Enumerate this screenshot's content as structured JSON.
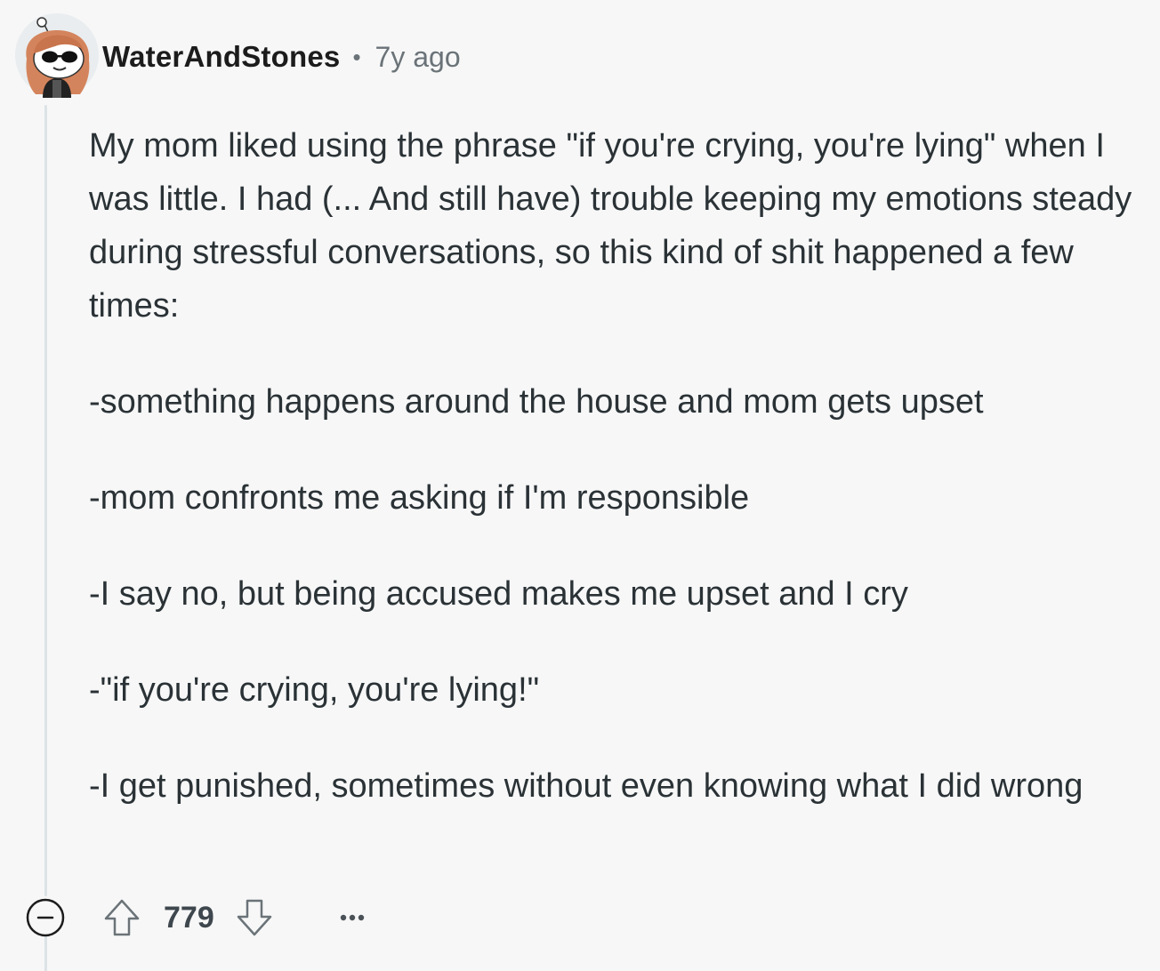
{
  "comment": {
    "author": "WaterAndStones",
    "separator": "•",
    "timestamp": "7y ago",
    "avatar_icon": "snoo-avatar-icon",
    "paragraphs": [
      "My mom liked using the phrase \"if you're crying, you're lying\" when I was little. I had (... And still have) trouble keeping my emotions steady during stressful conversations, so this kind of shit happened a few times:",
      "-something happens around the house and mom gets upset",
      "-mom confronts me asking if I'm responsible",
      "-I say no, but being accused makes me upset and I cry",
      "-\"if you're crying, you're lying!\"",
      "-I get punished, sometimes without even knowing what I did wrong"
    ],
    "actions": {
      "collapse_icon": "collapse-minus-icon",
      "upvote_icon": "upvote-arrow-icon",
      "score": "779",
      "downvote_icon": "downvote-arrow-icon",
      "more_icon": "ellipsis-icon"
    }
  },
  "colors": {
    "background": "#f7f7f7",
    "text": "#2a3236",
    "meta": "#6a7378",
    "thread_line": "#dde3e7"
  }
}
